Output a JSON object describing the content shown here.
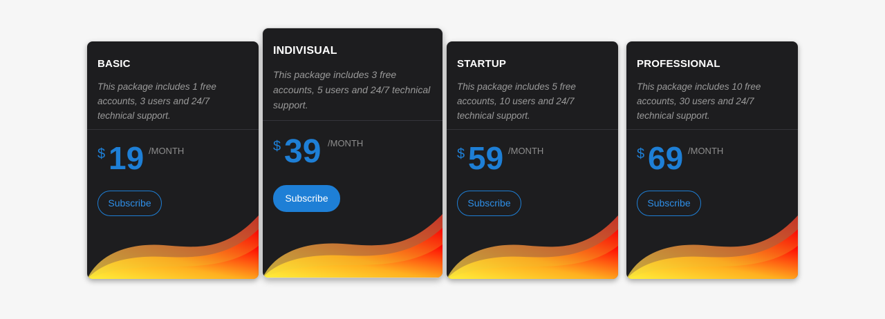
{
  "plans": [
    {
      "name": "BASIC",
      "description": "This package includes 1 free accounts, 3 users and 24/7 technical support.",
      "currency": "$",
      "price": "19",
      "period": "/MONTH",
      "button_label": "Subscribe",
      "featured": false
    },
    {
      "name": "INDIVISUAL",
      "description": "This package includes 3 free accounts, 5 users and 24/7 technical support.",
      "currency": "$",
      "price": "39",
      "period": "/MONTH",
      "button_label": "Subscribe",
      "featured": true
    },
    {
      "name": "STARTUP",
      "description": "This package includes 5 free accounts, 10 users and 24/7 technical support.",
      "currency": "$",
      "price": "59",
      "period": "/MONTH",
      "button_label": "Subscribe",
      "featured": false
    },
    {
      "name": "PROFESSIONAL",
      "description": "This package includes 10 free accounts, 30 users and 24/7 technical support.",
      "currency": "$",
      "price": "69",
      "period": "/MONTH",
      "button_label": "Subscribe",
      "featured": false
    }
  ],
  "colors": {
    "card_bg": "#1d1d1f",
    "accent": "#1e7fd6",
    "wave_start": "#ffef3a",
    "wave_mid": "#ff9a1f",
    "wave_end": "#ff0000"
  }
}
